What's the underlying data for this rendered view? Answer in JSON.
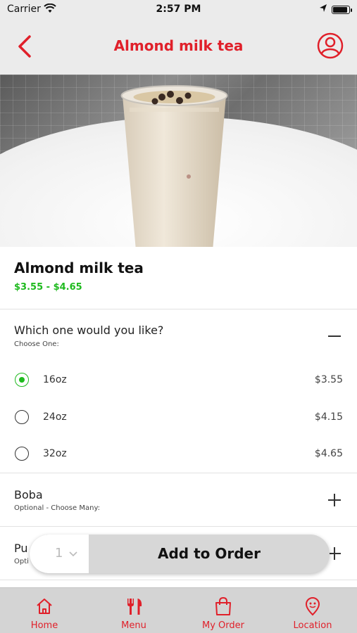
{
  "status_bar": {
    "carrier": "Carrier",
    "time": "2:57 PM"
  },
  "nav": {
    "title": "Almond milk tea",
    "back_icon": "chevron-left-icon",
    "profile_icon": "user-circle-icon"
  },
  "product": {
    "name": "Almond milk tea",
    "price_range": "$3.55 - $4.65"
  },
  "size_section": {
    "title": "Which one would you like?",
    "subtitle": "Choose One:",
    "toggle_icon": "minus-icon",
    "options": [
      {
        "label": "16oz",
        "price": "$3.55",
        "selected": true
      },
      {
        "label": "24oz",
        "price": "$4.15",
        "selected": false
      },
      {
        "label": "32oz",
        "price": "$4.65",
        "selected": false
      }
    ]
  },
  "boba_section": {
    "title": "Boba",
    "subtitle": "Optional - Choose Many:",
    "toggle_icon": "plus-icon"
  },
  "next_section": {
    "title": "Pu",
    "subtitle": "Opti",
    "toggle_icon": "plus-icon"
  },
  "add_bar": {
    "quantity": "1",
    "add_label": "Add to Order"
  },
  "tabs": [
    {
      "label": "Home",
      "icon": "home-icon"
    },
    {
      "label": "Menu",
      "icon": "fork-knife-icon"
    },
    {
      "label": "My Order",
      "icon": "shopping-bag-icon"
    },
    {
      "label": "Location",
      "icon": "map-pin-icon"
    }
  ],
  "colors": {
    "accent": "#e0202a",
    "price_green": "#1fba1f",
    "bar_gray": "#ebebeb",
    "tab_gray": "#d4d4d4"
  }
}
